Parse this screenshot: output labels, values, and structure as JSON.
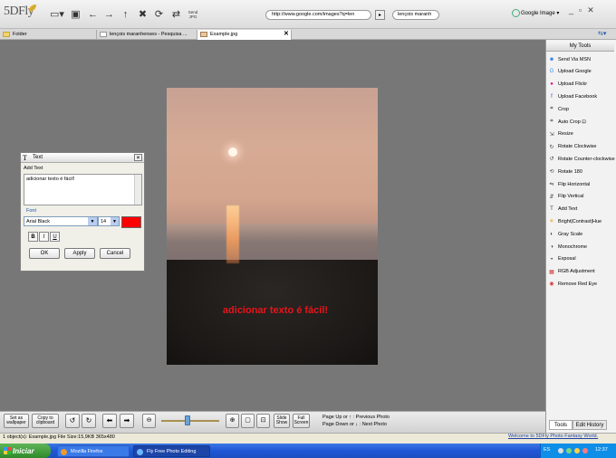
{
  "app": {
    "logo": "5DFly"
  },
  "browser": {
    "url": "http://www.google.com/images?q=len",
    "query": "lençois maranh",
    "search_engine": "Google Image"
  },
  "tabs": [
    {
      "label": "Folder"
    },
    {
      "label": "lençois maranhenses - Pesquisa ..."
    },
    {
      "label": "Example.jpg"
    }
  ],
  "toolbar": {
    "icons": [
      "display-icon",
      "save-icon",
      "back-icon",
      "forward-icon",
      "up-icon",
      "delete-icon",
      "refresh-icon",
      "swap-icon",
      "send-icon"
    ],
    "send_label": "Send\nJPG"
  },
  "photo": {
    "caption": "adicionar texto é fácil!",
    "caption_color": "#e8141a"
  },
  "text_dialog": {
    "title": "Text",
    "add_text_label": "Add Text",
    "text_value": "adicionar texto é fácil!",
    "font_label": "Font",
    "font_family": "Arial Black",
    "font_size": "14",
    "color": "#ff0000",
    "bold": "B",
    "italic": "I",
    "underline": "U",
    "ok": "OK",
    "apply": "Apply",
    "cancel": "Cancel"
  },
  "right_panel": {
    "title": "My Tools",
    "tools": [
      {
        "label": "Send Via MSN",
        "icon": "msn-icon"
      },
      {
        "label": "Upload Google",
        "icon": "google-icon"
      },
      {
        "label": "Upload Flickr",
        "icon": "flickr-icon"
      },
      {
        "label": "Upload Facebook",
        "icon": "facebook-icon"
      },
      {
        "label": "Crop",
        "icon": "crop-icon"
      },
      {
        "label": "Auto Crop ⊡",
        "icon": "auto-crop-icon"
      },
      {
        "label": "Resize",
        "icon": "resize-icon"
      },
      {
        "label": "Rotate Clockwise",
        "icon": "rotate-cw-icon"
      },
      {
        "label": "Rotate Counter-clockwise",
        "icon": "rotate-ccw-icon"
      },
      {
        "label": "Rotate 180",
        "icon": "rotate-180-icon"
      },
      {
        "label": "Flip Horizontal",
        "icon": "flip-h-icon"
      },
      {
        "label": "Flip Vertical",
        "icon": "flip-v-icon"
      },
      {
        "label": "Add Text",
        "icon": "text-icon"
      },
      {
        "label": "Bright|Contrast|Hue",
        "icon": "brightness-icon"
      },
      {
        "label": "Gray Scale",
        "icon": "grayscale-icon"
      },
      {
        "label": "Monochrome",
        "icon": "monochrome-icon"
      },
      {
        "label": "Exposal",
        "icon": "exposal-icon"
      },
      {
        "label": "RGB Adjustment",
        "icon": "rgb-icon"
      },
      {
        "label": "Remove Red Eye",
        "icon": "red-eye-icon"
      }
    ],
    "tab_tools": "Tools",
    "tab_history": "Edit History"
  },
  "bottom_toolbar": {
    "set_wallpaper": "Set as\nwallpaper",
    "copy_clipboard": "Copy to\nclipboard",
    "slide_show": "Slide\nShow",
    "full_screen": "Full\nScreen",
    "zoom_fraction": 0.45,
    "hint_prev": "Page Up or ↑ : Previous Photo",
    "hint_next": "Page Down or ↓ : Next Photo"
  },
  "status": {
    "left": "1 object(s):  Example.jpg  File Size:15,9KB  365x480",
    "right": "Welcome to 5DFly Photo Fantasy World."
  },
  "taskbar": {
    "start": "Iniciar",
    "tasks": [
      {
        "label": "Mozilla Firefox"
      },
      {
        "label": "Fly Free Photo Editing"
      }
    ],
    "lang": "ES",
    "clock": "12:37"
  }
}
